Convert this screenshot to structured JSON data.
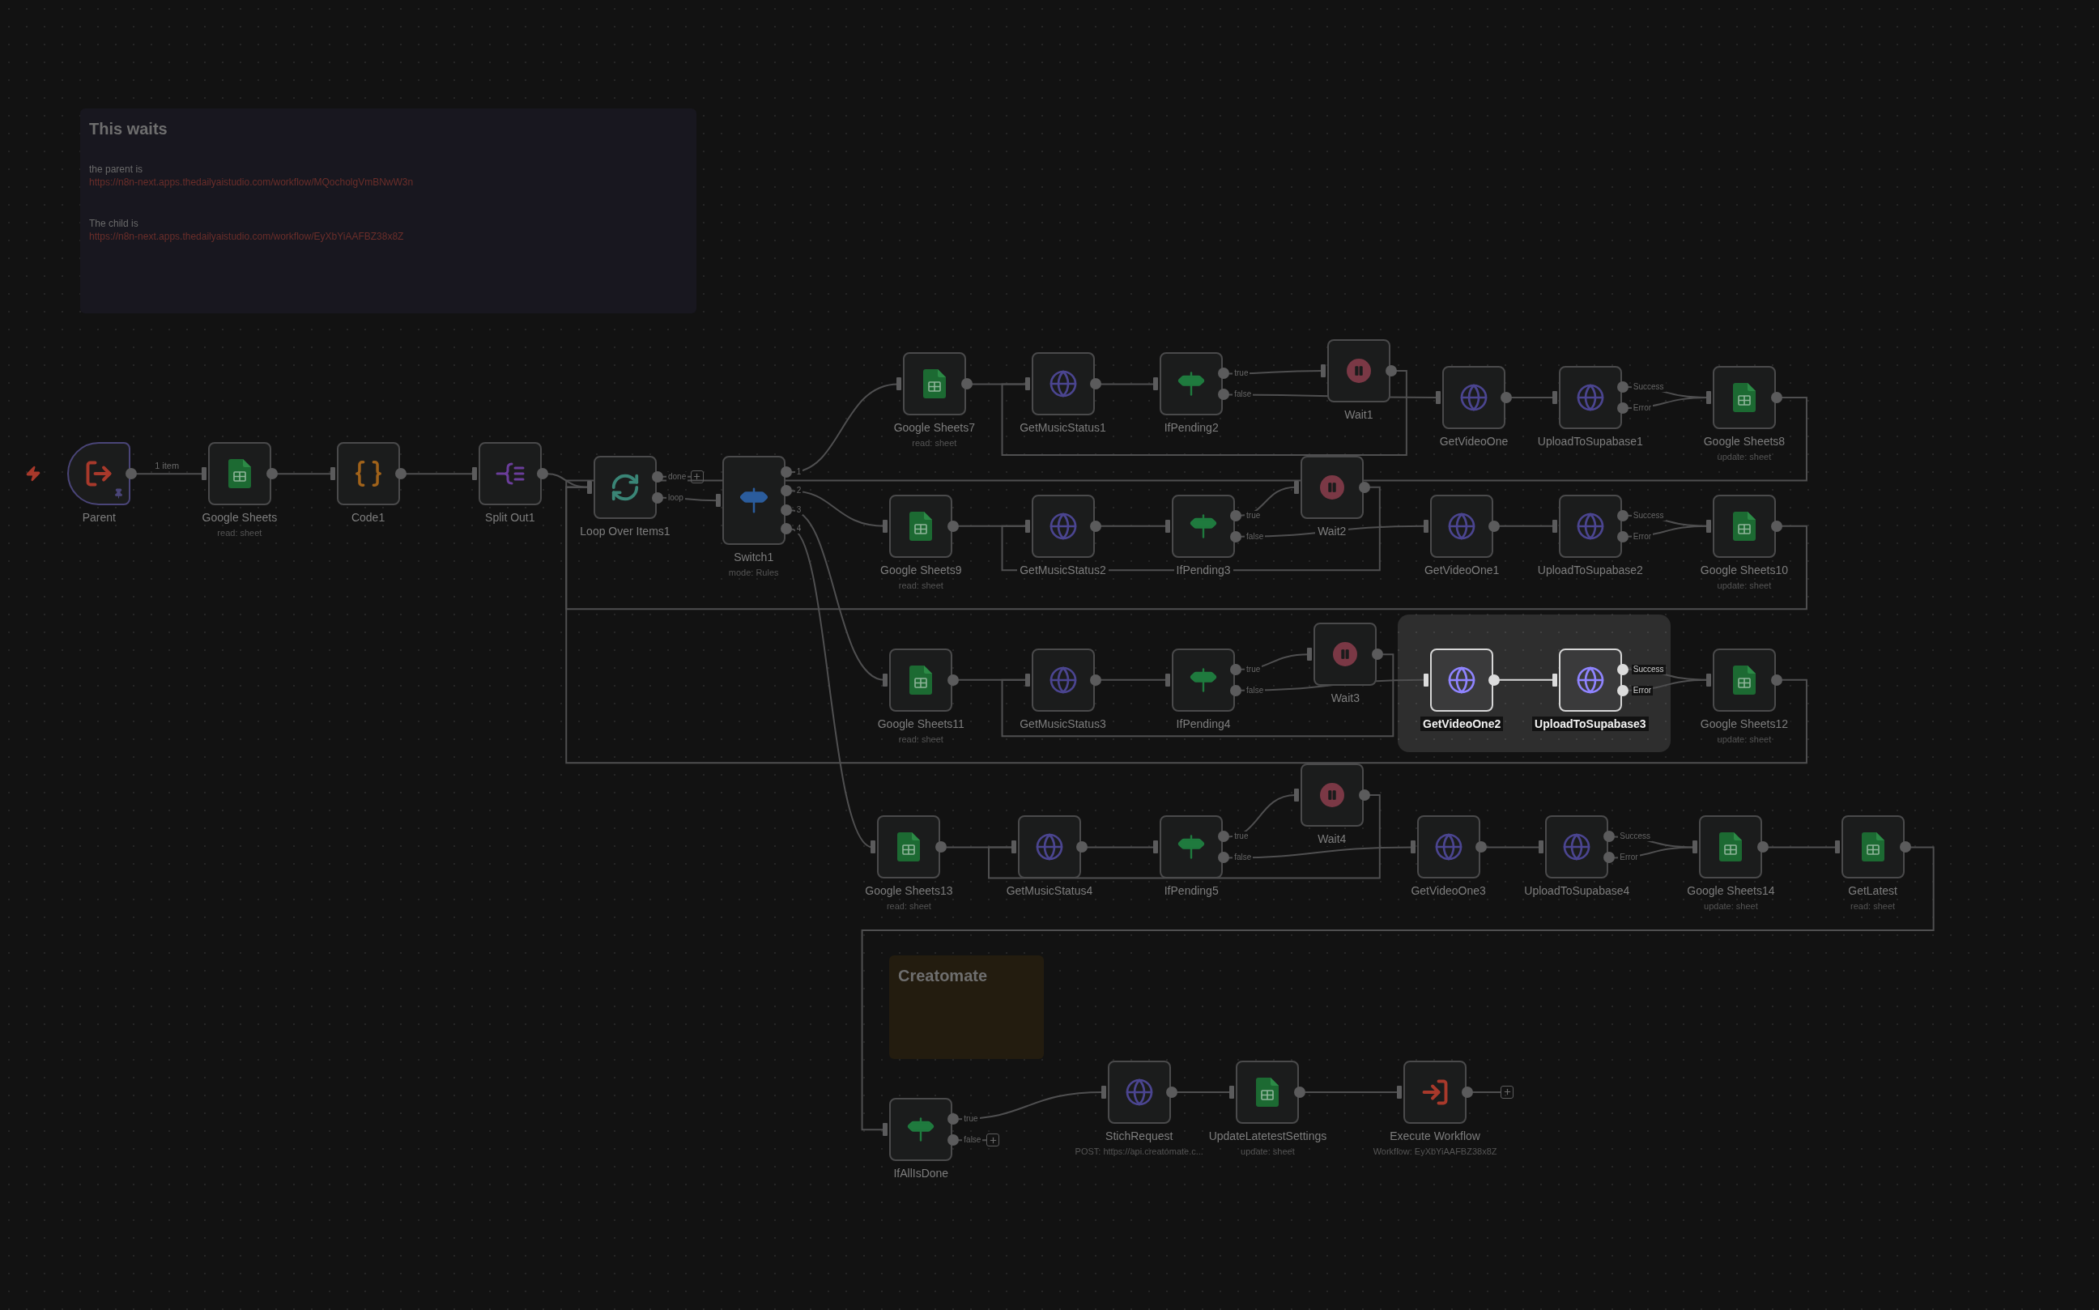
{
  "sticky_notes": [
    {
      "title": "This waits",
      "kind": "info",
      "lines": [
        {
          "text": "the parent is",
          "kind": "text"
        },
        {
          "text": "https://n8n-next.apps.thedailyaistudio.com/workflow/MQocholgVmBNwW3n",
          "kind": "link"
        },
        {
          "text": "The child is",
          "kind": "text"
        },
        {
          "text": "https://n8n-next.apps.thedailyaistudio.com/workflow/EyXbYiAAFBZ38x8Z",
          "kind": "link"
        }
      ]
    },
    {
      "title": "Creatomate",
      "kind": "warning"
    }
  ],
  "nodes": [
    {
      "name": "Parent",
      "kind": "trigger",
      "selected": false,
      "pinned": true,
      "edge_label": "1 item"
    },
    {
      "name": "Google Sheets",
      "subtitle": "read: sheet",
      "kind": "sheets",
      "selected": false
    },
    {
      "name": "Code1",
      "kind": "code",
      "selected": false
    },
    {
      "name": "Split Out1",
      "kind": "split",
      "selected": false
    },
    {
      "name": "Loop Over Items1",
      "kind": "loop",
      "selected": false,
      "outputs": [
        "done",
        "loop"
      ]
    },
    {
      "name": "Switch1",
      "subtitle": "mode: Rules",
      "kind": "switch",
      "selected": false,
      "outputs": [
        "1",
        "2",
        "3",
        "4"
      ]
    },
    {
      "name": "Google Sheets7",
      "subtitle": "read: sheet",
      "kind": "sheets",
      "selected": false
    },
    {
      "name": "GetMusicStatus1",
      "kind": "http",
      "selected": false
    },
    {
      "name": "IfPending2",
      "kind": "if",
      "selected": false,
      "outputs": [
        "true",
        "false"
      ]
    },
    {
      "name": "Wait1",
      "kind": "wait",
      "selected": false
    },
    {
      "name": "GetVideoOne",
      "kind": "http",
      "selected": false
    },
    {
      "name": "UploadToSupabase1",
      "kind": "http",
      "selected": false,
      "outputs": [
        "Success",
        "Error"
      ]
    },
    {
      "name": "Google Sheets8",
      "subtitle": "update: sheet",
      "kind": "sheets",
      "selected": false
    },
    {
      "name": "Google Sheets9",
      "subtitle": "read: sheet",
      "kind": "sheets",
      "selected": false
    },
    {
      "name": "GetMusicStatus2",
      "kind": "http",
      "selected": false
    },
    {
      "name": "IfPending3",
      "kind": "if",
      "selected": false,
      "outputs": [
        "true",
        "false"
      ]
    },
    {
      "name": "Wait2",
      "kind": "wait",
      "selected": false
    },
    {
      "name": "GetVideoOne1",
      "kind": "http",
      "selected": false
    },
    {
      "name": "UploadToSupabase2",
      "kind": "http",
      "selected": false,
      "outputs": [
        "Success",
        "Error"
      ]
    },
    {
      "name": "Google Sheets10",
      "subtitle": "update: sheet",
      "kind": "sheets",
      "selected": false
    },
    {
      "name": "Google Sheets11",
      "subtitle": "read: sheet",
      "kind": "sheets",
      "selected": false
    },
    {
      "name": "GetMusicStatus3",
      "kind": "http",
      "selected": false
    },
    {
      "name": "IfPending4",
      "kind": "if",
      "selected": false,
      "outputs": [
        "true",
        "false"
      ]
    },
    {
      "name": "Wait3",
      "kind": "wait",
      "selected": false
    },
    {
      "name": "GetVideoOne2",
      "kind": "http",
      "selected": true
    },
    {
      "name": "UploadToSupabase3",
      "kind": "http",
      "selected": true,
      "outputs": [
        "Success",
        "Error"
      ]
    },
    {
      "name": "Google Sheets12",
      "subtitle": "update: sheet",
      "kind": "sheets",
      "selected": false
    },
    {
      "name": "Google Sheets13",
      "subtitle": "read: sheet",
      "kind": "sheets",
      "selected": false
    },
    {
      "name": "GetMusicStatus4",
      "kind": "http",
      "selected": false
    },
    {
      "name": "IfPending5",
      "kind": "if",
      "selected": false,
      "outputs": [
        "true",
        "false"
      ]
    },
    {
      "name": "Wait4",
      "kind": "wait",
      "selected": false
    },
    {
      "name": "GetVideoOne3",
      "kind": "http",
      "selected": false
    },
    {
      "name": "UploadToSupabase4",
      "kind": "http",
      "selected": false,
      "outputs": [
        "Success",
        "Error"
      ]
    },
    {
      "name": "Google Sheets14",
      "subtitle": "update: sheet",
      "kind": "sheets",
      "selected": false
    },
    {
      "name": "GetLatest",
      "subtitle": "read: sheet",
      "kind": "sheets",
      "selected": false
    },
    {
      "name": "IfAllIsDone",
      "kind": "if",
      "selected": false,
      "outputs": [
        "true",
        "false"
      ]
    },
    {
      "name": "StichRequest",
      "subtitle": "POST: https://api.creatomate.c...",
      "kind": "http",
      "selected": false
    },
    {
      "name": "UpdateLatetestSettings",
      "subtitle": "update: sheet",
      "kind": "sheets",
      "selected": false
    },
    {
      "name": "Execute Workflow",
      "subtitle": "Workflow: EyXbYiAAFBZ38x8Z",
      "kind": "execute",
      "selected": false
    }
  ]
}
